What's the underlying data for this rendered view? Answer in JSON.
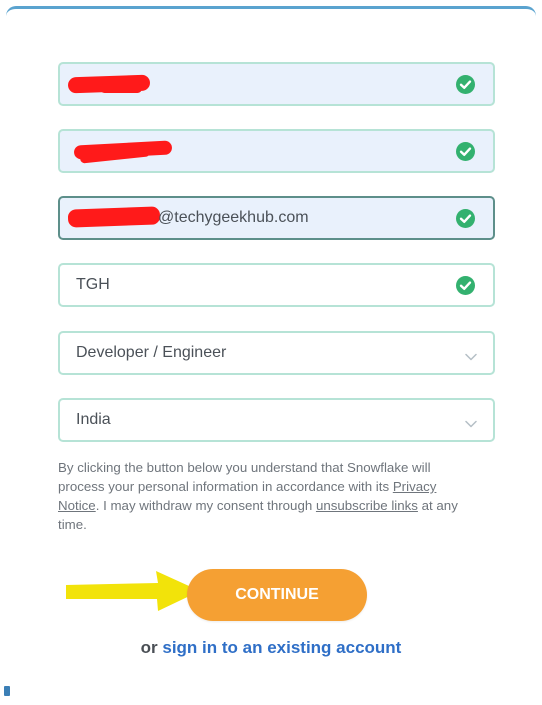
{
  "form": {
    "first_name": {
      "value": "",
      "redacted": true
    },
    "last_name": {
      "value": "",
      "redacted": true
    },
    "email": {
      "visible_part": "@techygeekhub.com",
      "redacted_prefix": true
    },
    "company": {
      "value": "TGH"
    },
    "role": {
      "selected": "Developer / Engineer"
    },
    "country": {
      "selected": "India"
    }
  },
  "notice": {
    "part1": "By clicking the button below you understand that Snowflake will process your personal information in accordance with its ",
    "privacy_link": "Privacy Notice",
    "part2": ". I may withdraw my consent through ",
    "unsubscribe_link": "unsubscribe links",
    "part3": " at any time."
  },
  "continue_button": {
    "label": "CONTINUE"
  },
  "signin": {
    "prefix": "or ",
    "link": "sign in to an existing account"
  },
  "colors": {
    "accent_orange": "#f5a033",
    "valid_green": "#33b16f",
    "link_blue": "#2f6fc7",
    "field_border": "#b6e3d6",
    "annotation_arrow": "#f2e30a",
    "redaction": "#ff1a1a"
  },
  "icons": {
    "valid": "check-circle-icon",
    "dropdown": "chevron-down-icon",
    "annotation": "arrow-right-icon"
  }
}
